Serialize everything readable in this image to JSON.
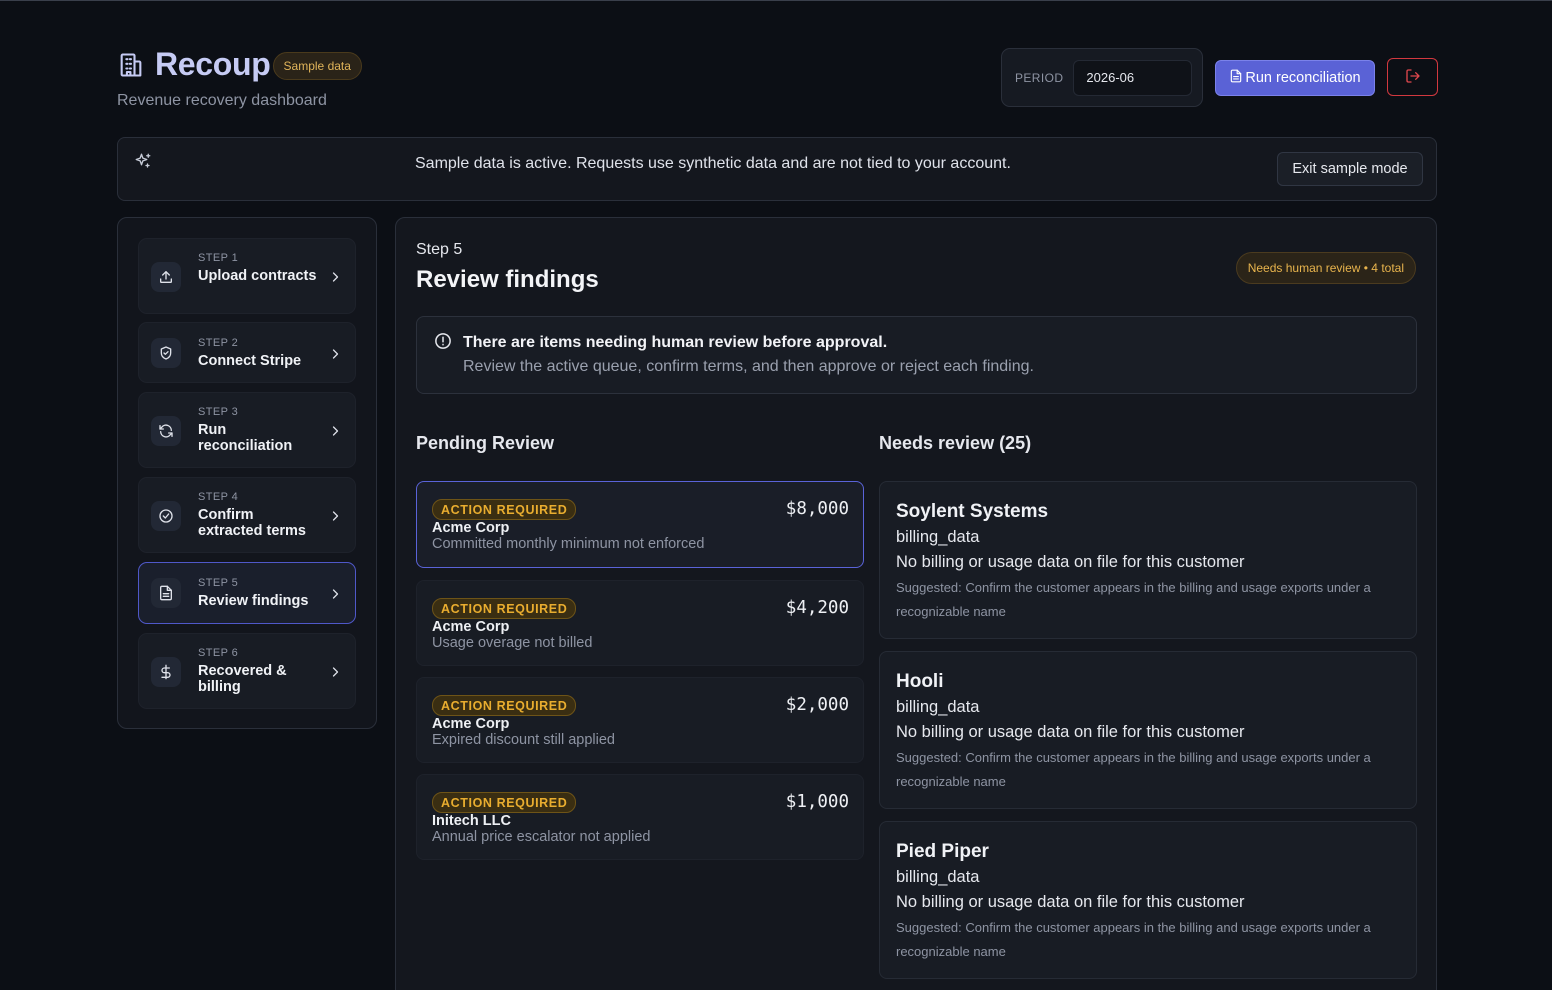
{
  "app": {
    "title": "Recoup",
    "subtitle": "Revenue recovery dashboard",
    "sample_badge": "Sample data",
    "brand_icon": "building-icon"
  },
  "header": {
    "period_label": "PERIOD",
    "period_value": "2026-06",
    "run_label": "Run reconciliation",
    "run_icon": "file-icon",
    "logout_icon": "logout-icon"
  },
  "banner": {
    "icon": "sparkles-icon",
    "text": "Sample data is active. Requests use synthetic data and are not tied to your account.",
    "exit_label": "Exit sample mode"
  },
  "steps": [
    {
      "kicker": "STEP 1",
      "label": "Upload contracts",
      "icon": "upload-icon"
    },
    {
      "kicker": "STEP 2",
      "label": "Connect Stripe",
      "icon": "shield-icon"
    },
    {
      "kicker": "STEP 3",
      "label": "Run reconciliation",
      "icon": "refresh-icon"
    },
    {
      "kicker": "STEP 4",
      "label": "Confirm extracted terms",
      "icon": "check-circle-icon"
    },
    {
      "kicker": "STEP 5",
      "label": "Review findings",
      "icon": "document-icon",
      "active": true
    },
    {
      "kicker": "STEP 6",
      "label": "Recovered & billing",
      "icon": "dollar-icon"
    }
  ],
  "main": {
    "kicker": "Step 5",
    "title": "Review findings",
    "review_pill": "Needs human review • 4 total",
    "alert": {
      "title": "There are items needing human review before approval.",
      "description": "Review the active queue, confirm terms, and then approve or reject each finding."
    },
    "pending_heading": "Pending Review",
    "needs_heading": "Needs review (25)"
  },
  "findings": [
    {
      "badge": "ACTION REQUIRED",
      "customer": "Acme Corp",
      "description": "Committed monthly minimum not enforced",
      "amount": "$8,000",
      "selected": true
    },
    {
      "badge": "ACTION REQUIRED",
      "customer": "Acme Corp",
      "description": "Usage overage not billed",
      "amount": "$4,200"
    },
    {
      "badge": "ACTION REQUIRED",
      "customer": "Acme Corp",
      "description": "Expired discount still applied",
      "amount": "$2,000"
    },
    {
      "badge": "ACTION REQUIRED",
      "customer": "Initech LLC",
      "description": "Annual price escalator not applied",
      "amount": "$1,000"
    }
  ],
  "needs_review": [
    {
      "name": "Soylent Systems",
      "field": "billing_data",
      "issue": "No billing or usage data on file for this customer",
      "suggestion": "Suggested: Confirm the customer appears in the billing and usage exports under a recognizable name"
    },
    {
      "name": "Hooli",
      "field": "billing_data",
      "issue": "No billing or usage data on file for this customer",
      "suggestion": "Suggested: Confirm the customer appears in the billing and usage exports under a recognizable name"
    },
    {
      "name": "Pied Piper",
      "field": "billing_data",
      "issue": "No billing or usage data on file for this customer",
      "suggestion": "Suggested: Confirm the customer appears in the billing and usage exports under a recognizable name"
    }
  ],
  "colors": {
    "accent": "#5a62d6",
    "warning": "#e9ad2f",
    "danger": "#d2383f",
    "background": "#0c0f15"
  }
}
